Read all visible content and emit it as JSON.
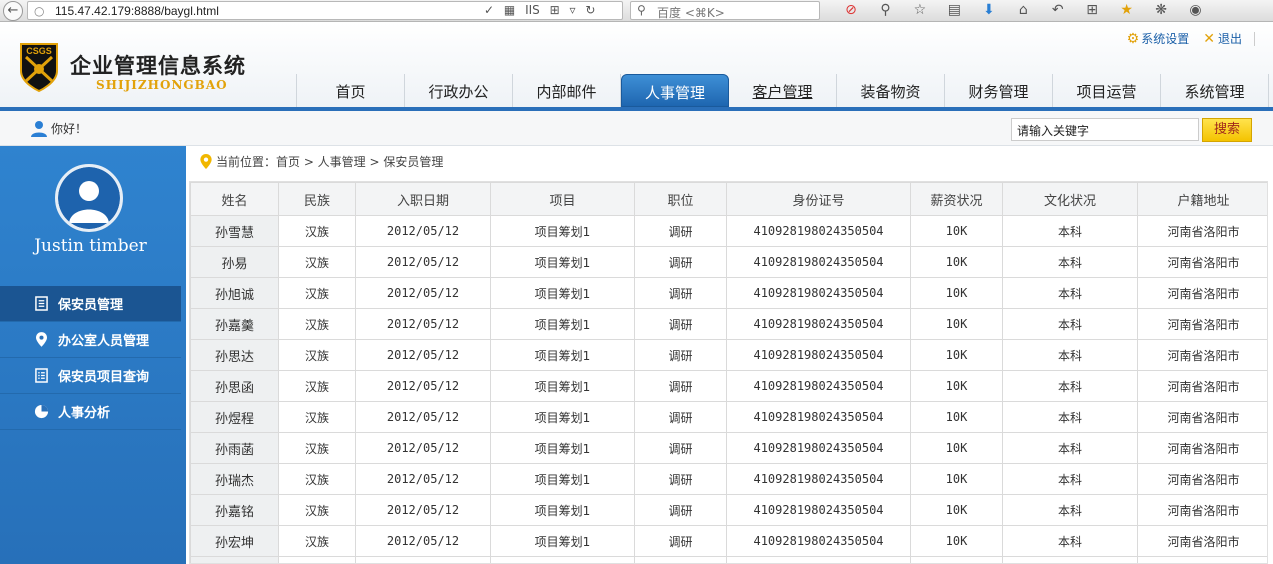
{
  "browser": {
    "url": "115.47.42.179:8888/baygl.html",
    "search_placeholder": "百度 <⌘K>",
    "url_icons": [
      "✓",
      "▦",
      "IIS",
      "⊞",
      "▿"
    ]
  },
  "header": {
    "title": "企业管理信息系统",
    "subtitle": "SHIJIZHONGBAO",
    "logo_text": "CSGS",
    "settings_label": "系统设置",
    "logout_label": "退出",
    "nav": [
      "首页",
      "行政办公",
      "内部邮件",
      "人事管理",
      "客户管理",
      "装备物资",
      "财务管理",
      "项目运营",
      "系统管理"
    ],
    "active_nav": "人事管理"
  },
  "greeting": "你好！",
  "search": {
    "value": "请输入关键字",
    "button": "搜索"
  },
  "sidebar": {
    "username": "Justin timber",
    "menu": [
      {
        "label": "保安员管理",
        "icon": "document-icon"
      },
      {
        "label": "办公室人员管理",
        "icon": "location-pin-icon"
      },
      {
        "label": "保安员项目查询",
        "icon": "list-icon"
      },
      {
        "label": "人事分析",
        "icon": "pie-chart-icon"
      }
    ]
  },
  "breadcrumb": "当前位置：首页 > 人事管理 > 保安员管理",
  "table": {
    "columns": [
      "姓名",
      "民族",
      "入职日期",
      "项目",
      "职位",
      "身份证号",
      "薪资状况",
      "文化状况",
      "户籍地址"
    ],
    "rows": [
      [
        "孙雪慧",
        "汉族",
        "2012/05/12",
        "项目筹划1",
        "调研",
        "410928198024350504",
        "10K",
        "本科",
        "河南省洛阳市"
      ],
      [
        "孙易",
        "汉族",
        "2012/05/12",
        "项目筹划1",
        "调研",
        "410928198024350504",
        "10K",
        "本科",
        "河南省洛阳市"
      ],
      [
        "孙旭诚",
        "汉族",
        "2012/05/12",
        "项目筹划1",
        "调研",
        "410928198024350504",
        "10K",
        "本科",
        "河南省洛阳市"
      ],
      [
        "孙嘉羹",
        "汉族",
        "2012/05/12",
        "项目筹划1",
        "调研",
        "410928198024350504",
        "10K",
        "本科",
        "河南省洛阳市"
      ],
      [
        "孙思达",
        "汉族",
        "2012/05/12",
        "项目筹划1",
        "调研",
        "410928198024350504",
        "10K",
        "本科",
        "河南省洛阳市"
      ],
      [
        "孙思函",
        "汉族",
        "2012/05/12",
        "项目筹划1",
        "调研",
        "410928198024350504",
        "10K",
        "本科",
        "河南省洛阳市"
      ],
      [
        "孙煜程",
        "汉族",
        "2012/05/12",
        "项目筹划1",
        "调研",
        "410928198024350504",
        "10K",
        "本科",
        "河南省洛阳市"
      ],
      [
        "孙雨菡",
        "汉族",
        "2012/05/12",
        "项目筹划1",
        "调研",
        "410928198024350504",
        "10K",
        "本科",
        "河南省洛阳市"
      ],
      [
        "孙瑞杰",
        "汉族",
        "2012/05/12",
        "项目筹划1",
        "调研",
        "410928198024350504",
        "10K",
        "本科",
        "河南省洛阳市"
      ],
      [
        "孙嘉铭",
        "汉族",
        "2012/05/12",
        "项目筹划1",
        "调研",
        "410928198024350504",
        "10K",
        "本科",
        "河南省洛阳市"
      ],
      [
        "孙宏坤",
        "汉族",
        "2012/05/12",
        "项目筹划1",
        "调研",
        "410928198024350504",
        "10K",
        "本科",
        "河南省洛阳市"
      ],
      [
        "",
        "",
        "",
        "",
        "",
        "",
        "",
        "",
        ""
      ]
    ]
  },
  "colors": {
    "brand_blue": "#2a6fb9",
    "sidebar_blue": "#2f83cf",
    "accent_yellow": "#f4c300",
    "subtitle_gold": "#e2a20a"
  }
}
